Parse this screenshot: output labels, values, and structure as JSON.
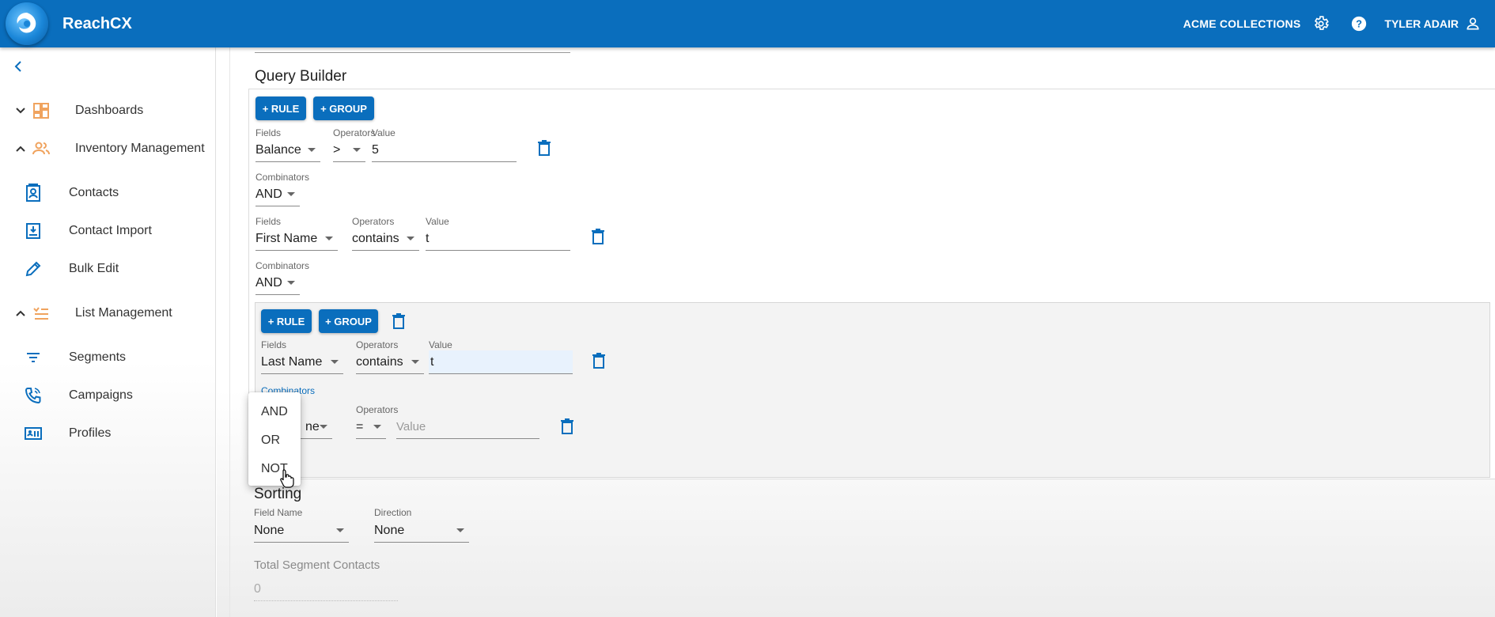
{
  "header": {
    "app_title": "ReachCX",
    "org_name": "ACME COLLECTIONS",
    "user_name": "TYLER ADAIR",
    "brand_color": "#0a6ebd"
  },
  "sidebar": {
    "items": [
      {
        "label": "Dashboards",
        "icon": "dashboard-icon"
      },
      {
        "label": "Inventory Management",
        "icon": "people-icon"
      },
      {
        "label": "Contacts",
        "icon": "contact-card-icon"
      },
      {
        "label": "Contact Import",
        "icon": "import-icon"
      },
      {
        "label": "Bulk Edit",
        "icon": "pencil-icon"
      },
      {
        "label": "List Management",
        "icon": "list-icon"
      },
      {
        "label": "Segments",
        "icon": "filter-icon"
      },
      {
        "label": "Campaigns",
        "icon": "phone-icon"
      },
      {
        "label": "Profiles",
        "icon": "profile-card-icon"
      }
    ]
  },
  "query_builder": {
    "title": "Query Builder",
    "add_rule_label": "+ RULE",
    "add_group_label": "+ GROUP",
    "labels": {
      "fields": "Fields",
      "operators": "Operators",
      "value": "Value",
      "combinators": "Combinators"
    },
    "rule1": {
      "field": "Balance",
      "operator": ">",
      "value": "5"
    },
    "combinator1": "AND",
    "rule2": {
      "field": "First Name",
      "operator": "contains",
      "value": "t"
    },
    "combinator2": "AND",
    "group": {
      "rule1": {
        "field": "Last Name",
        "operator": "contains",
        "value": "t"
      },
      "rule2": {
        "field_partial": "ne",
        "operator": "=",
        "value_placeholder": "Value"
      }
    },
    "combinator_menu": [
      "AND",
      "OR",
      "NOT"
    ]
  },
  "sorting": {
    "title": "Sorting",
    "field_name_label": "Field Name",
    "field_name_value": "None",
    "direction_label": "Direction",
    "direction_value": "None"
  },
  "total": {
    "label": "Total Segment Contacts",
    "value": "0"
  }
}
